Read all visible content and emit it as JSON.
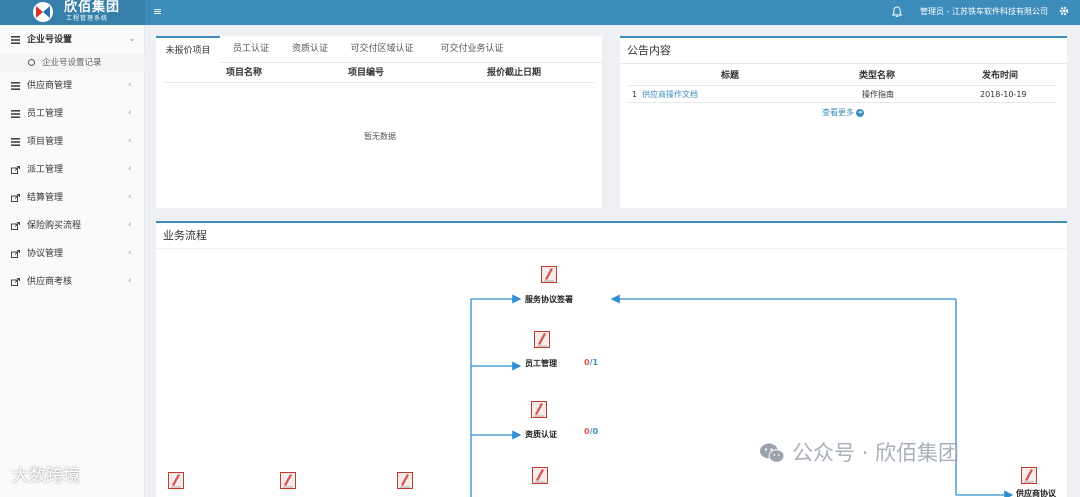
{
  "header": {
    "brand": "欣佰集团",
    "brand_sub": "工程管理系统",
    "user": "管理员 - 江苏铁车软件科技有限公司",
    "colors": {
      "bar": "#3c8dbc",
      "logo_bg": "#367fa9"
    }
  },
  "sidebar": {
    "items": [
      {
        "label": "企业号设置",
        "icon": "list-icon",
        "arrow": "⌄"
      },
      {
        "label": "供应商管理",
        "icon": "list-icon",
        "arrow": "‹"
      },
      {
        "label": "员工管理",
        "icon": "list-icon",
        "arrow": "‹"
      },
      {
        "label": "项目管理",
        "icon": "list-icon",
        "arrow": "‹"
      },
      {
        "label": "派工管理",
        "icon": "share-icon",
        "arrow": "‹"
      },
      {
        "label": "结算管理",
        "icon": "share-icon",
        "arrow": "‹"
      },
      {
        "label": "保险购买流程",
        "icon": "share-icon",
        "arrow": "‹"
      },
      {
        "label": "协议管理",
        "icon": "share-icon",
        "arrow": "‹"
      },
      {
        "label": "供应商考核",
        "icon": "share-icon",
        "arrow": "‹"
      }
    ],
    "subitem": "企业号设置记录"
  },
  "tabs_panel": {
    "tabs": [
      "未报价项目",
      "员工认证",
      "资质认证",
      "可交付区域认证",
      "可交付业务认证"
    ],
    "columns": [
      "项目名称",
      "项目编号",
      "报价截止日期"
    ],
    "empty": "暂无数据"
  },
  "notice_panel": {
    "title": "公告内容",
    "columns": [
      "标题",
      "类型名称",
      "发布时间"
    ],
    "rows": [
      {
        "no": "1",
        "title": "供应商操作文档",
        "type": "操作指南",
        "date": "2018-10-19"
      }
    ],
    "more": "查看更多"
  },
  "flow_panel": {
    "title": "业务流程",
    "nodes": [
      {
        "label": "服务协议签署"
      },
      {
        "label": "员工管理",
        "count_red": "0",
        "count_blue": "1"
      },
      {
        "label": "资质认证",
        "count_red": "0",
        "count_blue": "0"
      },
      {
        "label": "供应商协议"
      }
    ]
  },
  "watermarks": {
    "left": "大数跨境",
    "right": "公众号 · 欣佰集团"
  }
}
